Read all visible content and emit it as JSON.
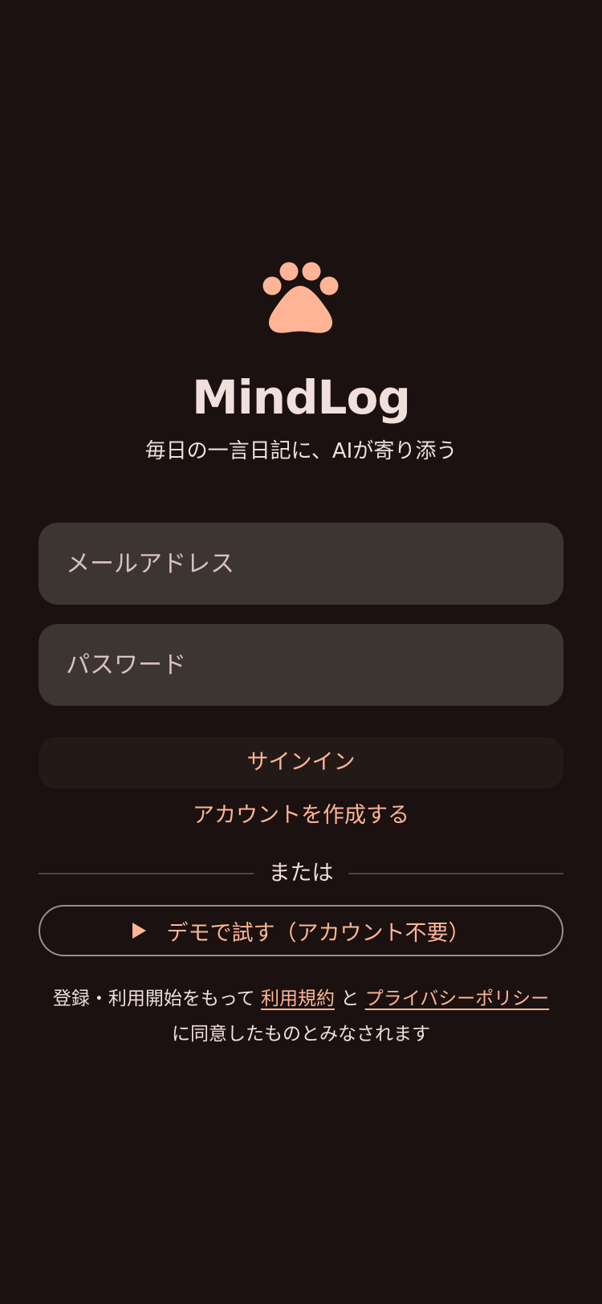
{
  "app": {
    "title": "MindLog",
    "tagline": "毎日の一言日記に、AIが寄り添う",
    "logo_icon": "paw-icon",
    "accent_color": "#ffb595",
    "background_color": "#1a1110"
  },
  "form": {
    "email_placeholder": "メールアドレス",
    "email_value": "",
    "password_placeholder": "パスワード",
    "password_value": "",
    "signin_label": "サインイン",
    "create_account_label": "アカウントを作成する"
  },
  "divider": {
    "label": "または"
  },
  "demo": {
    "icon": "play-icon",
    "label": "デモで試す（アカウント不要）"
  },
  "legal": {
    "prefix": "登録・利用開始をもって",
    "terms_label": "利用規約",
    "conjunction": "と",
    "privacy_label": "プライバシーポリシー",
    "suffix": "に同意したものとみなされます"
  }
}
